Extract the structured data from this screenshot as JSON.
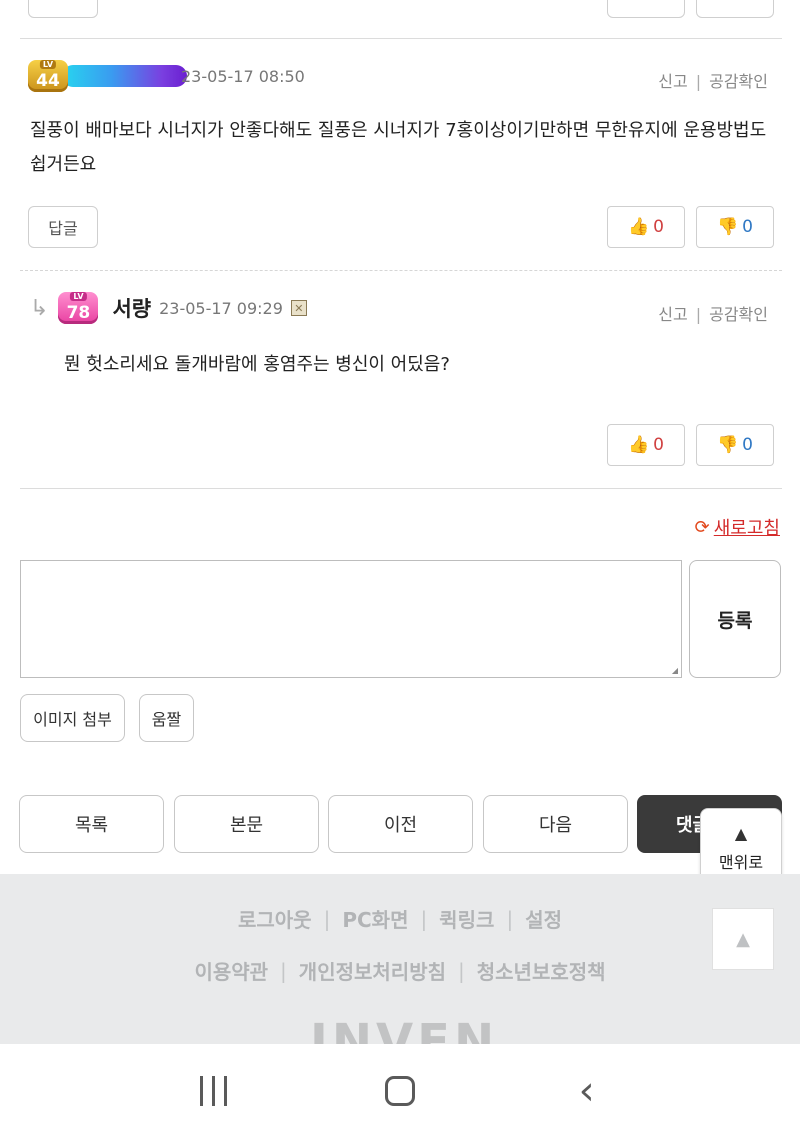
{
  "comments": [
    {
      "level": "44",
      "level_prefix": "LV",
      "date": "23-05-17 08:50",
      "body": "질풍이 배마보다 시너지가 안좋다해도 질풍은 시너지가 7홍이상이기만하면 무한유지에 운용방법도 쉽거든요",
      "report": "신고",
      "empathy": "공감확인",
      "reply_label": "답글",
      "up_count": "0",
      "down_count": "0"
    },
    {
      "level": "78",
      "level_prefix": "LV",
      "nickname": "서량",
      "date": "23-05-17 09:29",
      "body": "뭔 헛소리세요 돌개바람에 홍염주는 병신이 어딨음?",
      "report": "신고",
      "empathy": "공감확인",
      "up_count": "0",
      "down_count": "0"
    }
  ],
  "reply_arrow": "↳",
  "refresh_label": "새로고침",
  "write": {
    "submit_label": "등록",
    "attach_image": "이미지 첨부",
    "animated": "움짤"
  },
  "bottom_nav": [
    "목록",
    "본문",
    "이전",
    "다음",
    "댓글"
  ],
  "to_top_label": "맨위로",
  "footer": {
    "row1": [
      "로그아웃",
      "PC화면",
      "퀵링크",
      "설정"
    ],
    "row2": [
      "이용약관",
      "개인정보처리방침",
      "청소년보호정책"
    ],
    "logo": "INVEN"
  },
  "icons": {
    "thumb_up": "thumb-up-icon",
    "thumb_down": "thumb-down-icon",
    "refresh": "refresh-icon",
    "up_arrow": "up-arrow-icon"
  }
}
